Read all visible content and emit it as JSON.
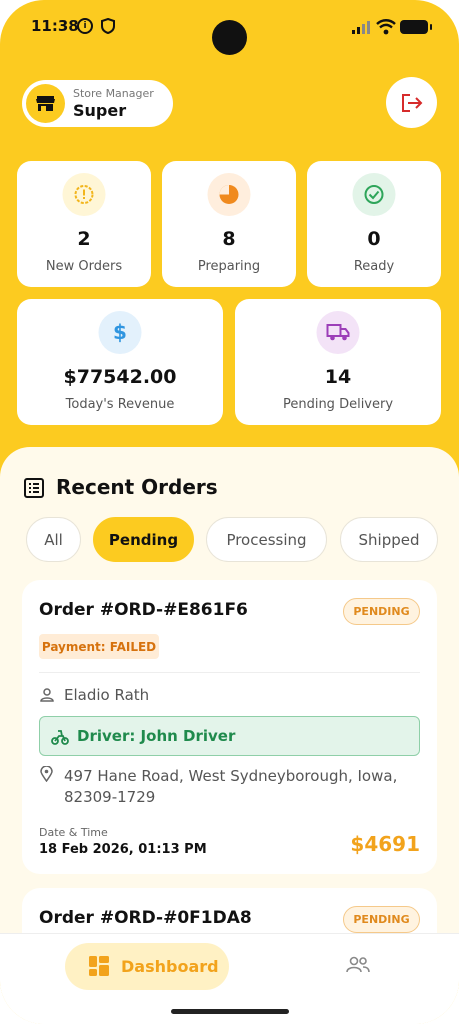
{
  "status_bar": {
    "time": "11:38"
  },
  "header": {
    "role": "Store Manager",
    "name": "Super"
  },
  "stats": {
    "new_orders": {
      "value": "2",
      "label": "New Orders",
      "color": "#f2b51c"
    },
    "preparing": {
      "value": "8",
      "label": "Preparing",
      "color": "#f08a1e"
    },
    "ready": {
      "value": "0",
      "label": "Ready",
      "color": "#2ea55a"
    },
    "revenue": {
      "value": "$77542.00",
      "label": "Today's Revenue",
      "color": "#2f95e0"
    },
    "pending_delivery": {
      "value": "14",
      "label": "Pending Delivery",
      "color": "#9c3fb8"
    }
  },
  "recent": {
    "title": "Recent Orders",
    "filters": [
      {
        "label": "All",
        "active": false
      },
      {
        "label": "Pending",
        "active": true
      },
      {
        "label": "Processing",
        "active": false
      },
      {
        "label": "Shipped",
        "active": false
      }
    ],
    "orders": [
      {
        "id": "Order #ORD-#E861F6",
        "status": "PENDING",
        "payment": "Payment: FAILED",
        "customer": "Eladio Rath",
        "driver": "Driver: John Driver",
        "address": "497 Hane Road, West Sydneyborough, Iowa, 82309-1729",
        "datetime_label": "Date & Time",
        "datetime": "18 Feb 2026, 01:13 PM",
        "amount": "$4691"
      },
      {
        "id": "Order #ORD-#0F1DA8",
        "status": "PENDING"
      }
    ]
  },
  "nav": {
    "dashboard": "Dashboard"
  },
  "colors": {
    "accent": "#fccb20",
    "amount": "#f2a31c",
    "sheet": "#fffaeb"
  }
}
